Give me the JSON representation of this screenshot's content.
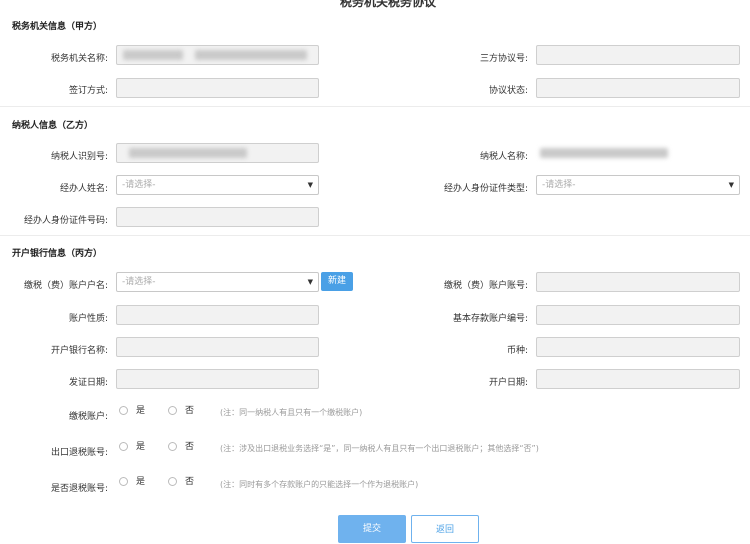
{
  "page": {
    "title": "税务机关税务协议"
  },
  "section1": {
    "title": "税务机关信息（甲方）",
    "tax_office_name_label": "税务机关名称:",
    "agreement_no_label": "三方协议号:",
    "sign_method_label": "签订方式:",
    "agreement_status_label": "协议状态:"
  },
  "section2": {
    "title": "纳税人信息（乙方）",
    "taxpayer_id_label": "纳税人识别号:",
    "taxpayer_name_label": "纳税人名称:",
    "agent_name_label": "经办人姓名:",
    "agent_name_placeholder": "-请选择-",
    "agent_id_type_label": "经办人身份证件类型:",
    "agent_id_type_placeholder": "-请选择-",
    "agent_id_no_label": "经办人身份证件号码:"
  },
  "section3": {
    "title": "开户银行信息（丙方）",
    "account_name_label": "缴税（费）账户户名:",
    "account_name_placeholder": "-请选择-",
    "new_button": "新建",
    "account_no_label": "缴税（费）账户账号:",
    "account_nature_label": "账户性质:",
    "basic_deposit_label": "基本存款账户编号:",
    "bank_name_label": "开户银行名称:",
    "currency_label": "币种:",
    "issue_date_label": "发证日期:",
    "open_date_label": "开户日期:"
  },
  "radios": [
    {
      "label": "缴税账户:",
      "yes": "是",
      "no": "否",
      "note": "(注：同一纳税人有且只有一个缴税账户)"
    },
    {
      "label": "出口退税账号:",
      "yes": "是",
      "no": "否",
      "note": "(注：涉及出口退税业务选择“是”，同一纳税人有且只有一个出口退税账户；其他选择“否”)"
    },
    {
      "label": "是否退税账号:",
      "yes": "是",
      "no": "否",
      "note": "(注：同时有多个存款账户的只能选择一个作为退税账户)"
    }
  ],
  "actions": {
    "submit": "提交",
    "back": "返回"
  },
  "colors": {
    "accent": "#4aa0e6",
    "field_bg": "#f2f2f2"
  }
}
